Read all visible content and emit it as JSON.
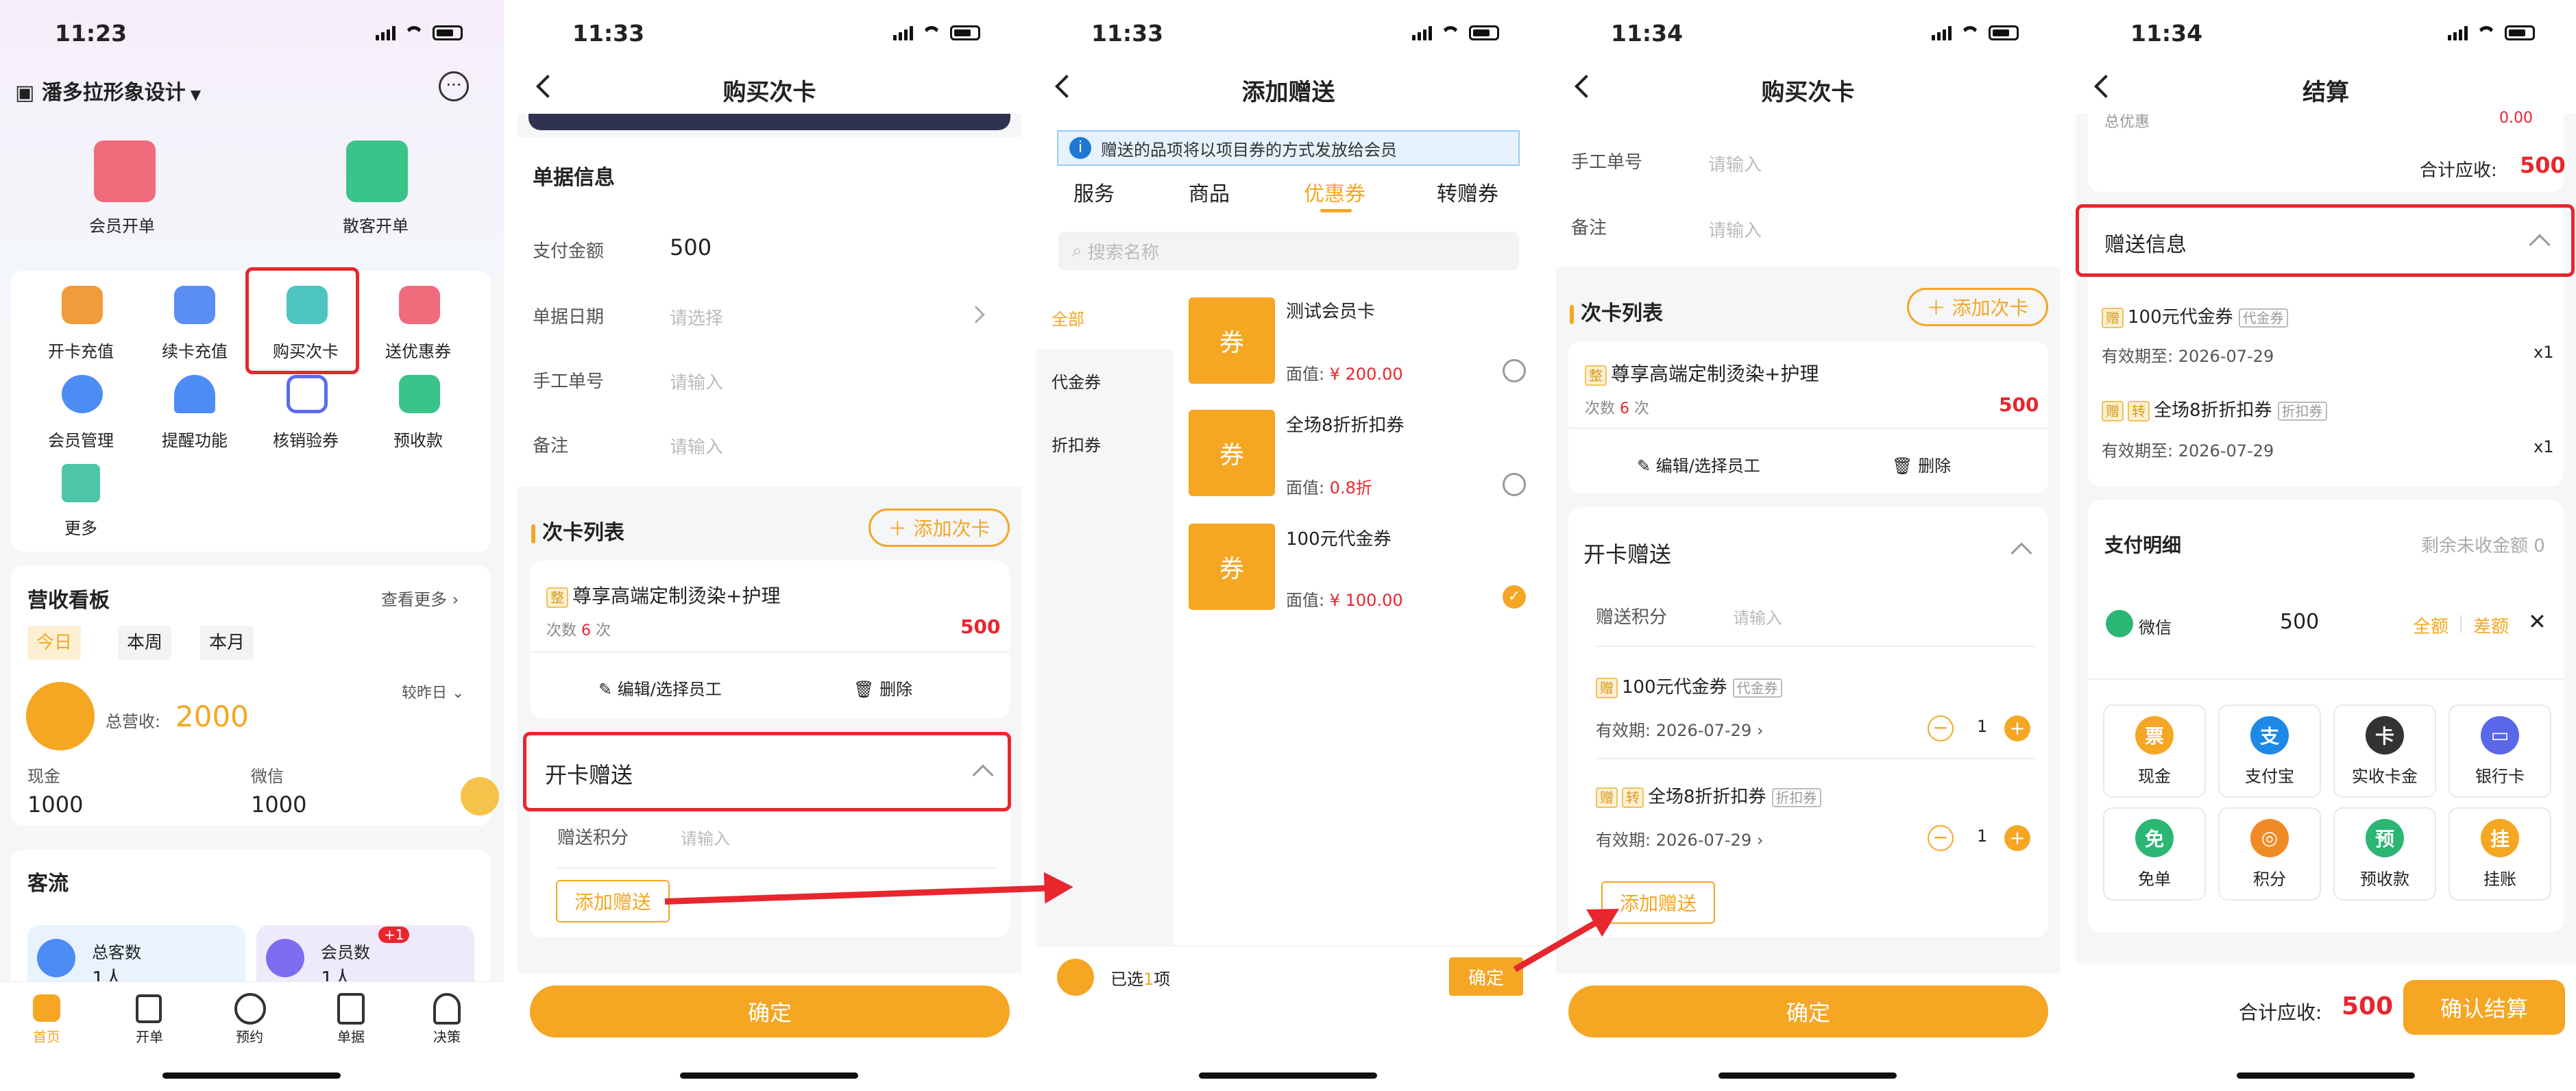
{
  "s1": {
    "time": "11:23",
    "store": "潘多拉形象设计",
    "top": [
      "会员开单",
      "散客开单"
    ],
    "grid": [
      "开卡充值",
      "续卡充值",
      "购买次卡",
      "送优惠券",
      "会员管理",
      "提醒功能",
      "核销验券",
      "预收款",
      "更多"
    ],
    "rev_title": "营收看板",
    "more": "查看更多",
    "periods": [
      "今日",
      "本周",
      "本月"
    ],
    "compare": "较昨日",
    "total_label": "总营收:",
    "total": "2000",
    "cash_label": "现金",
    "cash": "1000",
    "wx_label": "微信",
    "wx": "1000",
    "flow_title": "客流",
    "total_cust": "总客数",
    "members": "会员数",
    "badge": "+1",
    "unit": "1人",
    "tabs": [
      "首页",
      "开单",
      "预约",
      "单据",
      "决策"
    ]
  },
  "s2": {
    "time": "11:33",
    "title": "购买次卡",
    "doc": "单据信息",
    "pay_label": "支付金额",
    "pay": "500",
    "date_label": "单据日期",
    "date_ph": "请选择",
    "staff_label": "手工单号",
    "staff_ph": "请输入",
    "remark_label": "备注",
    "remark_ph": "请输入",
    "list": "次卡列表",
    "add": "＋ 添加次卡",
    "item_tag": "整",
    "item": "尊享高端定制烫染+护理",
    "count_pre": "次数",
    "count": "6",
    "count_suf": "次",
    "price": "500",
    "edit": "编辑/选择员工",
    "del": "删除",
    "gift": "开卡赠送",
    "points": "赠送积分",
    "points_ph": "请输入",
    "add_gift": "添加赠送",
    "ok": "确定"
  },
  "s3": {
    "time": "11:33",
    "title": "添加赠送",
    "notice": "赠送的品项将以项目券的方式发放给会员",
    "tabs": [
      "服务",
      "商品",
      "优惠券",
      "转赠券"
    ],
    "search": "搜索名称",
    "cats": [
      "全部",
      "代金券",
      "折扣券"
    ],
    "q": "券",
    "items": [
      {
        "name": "测试会员卡",
        "label": "面值:",
        "val": "¥ 200.00"
      },
      {
        "name": "全场8折折扣券",
        "label": "面值:",
        "val": "0.8折"
      },
      {
        "name": "100元代金券",
        "label": "面值:",
        "val": "¥ 100.00"
      }
    ],
    "sel_pre": "已选",
    "sel_n": "1",
    "sel_suf": "项",
    "ok": "确定"
  },
  "s4": {
    "time": "11:34",
    "title": "购买次卡",
    "staff_label": "手工单号",
    "staff_ph": "请输入",
    "remark_label": "备注",
    "remark_ph": "请输入",
    "list": "次卡列表",
    "add": "＋ 添加次卡",
    "item_tag": "整",
    "item": "尊享高端定制烫染+护理",
    "count_pre": "次数",
    "count": "6",
    "count_suf": "次",
    "price": "500",
    "edit": "编辑/选择员工",
    "del": "删除",
    "gift": "开卡赠送",
    "points": "赠送积分",
    "points_ph": "请输入",
    "g1_tag": "赠",
    "g1": "100元代金券",
    "g1_type": "代金券",
    "g2_tag1": "赠",
    "g2_tag2": "转",
    "g2": "全场8折折扣券",
    "g2_type": "折扣券",
    "exp_label": "有效期:",
    "exp": "2026-07-29",
    "qty": "1",
    "add_gift": "添加赠送",
    "ok": "确定"
  },
  "s5": {
    "time": "11:34",
    "title": "结算",
    "total_disc": "总优惠",
    "disc_val": "0.00",
    "sum_label": "合计应收:",
    "sum": "500",
    "gift_info": "赠送信息",
    "g1_tag": "赠",
    "g1": "100元代金券",
    "g1_type": "代金券",
    "g2_tag1": "赠",
    "g2_tag2": "转",
    "g2": "全场8折折扣券",
    "g2_type": "折扣券",
    "exp_label": "有效期至:",
    "exp": "2026-07-29",
    "x1": "x1",
    "pay_title": "支付明细",
    "remain": "剩余未收金额 0",
    "wx": "微信",
    "wx_amt": "500",
    "all": "全额",
    "diff": "差额",
    "methods": [
      "现金",
      "支付宝",
      "实收卡金",
      "银行卡",
      "免单",
      "积分",
      "预收款",
      "挂账"
    ],
    "method_icons": [
      "票",
      "支",
      "卡",
      "▭",
      "免",
      "◎",
      "预",
      "挂"
    ],
    "method_colors": [
      "#f5a623",
      "#1e88e5",
      "#333333",
      "#5a67e8",
      "#2bb673",
      "#f08a24",
      "#2bb673",
      "#f5a623"
    ],
    "confirm": "确认结算"
  }
}
